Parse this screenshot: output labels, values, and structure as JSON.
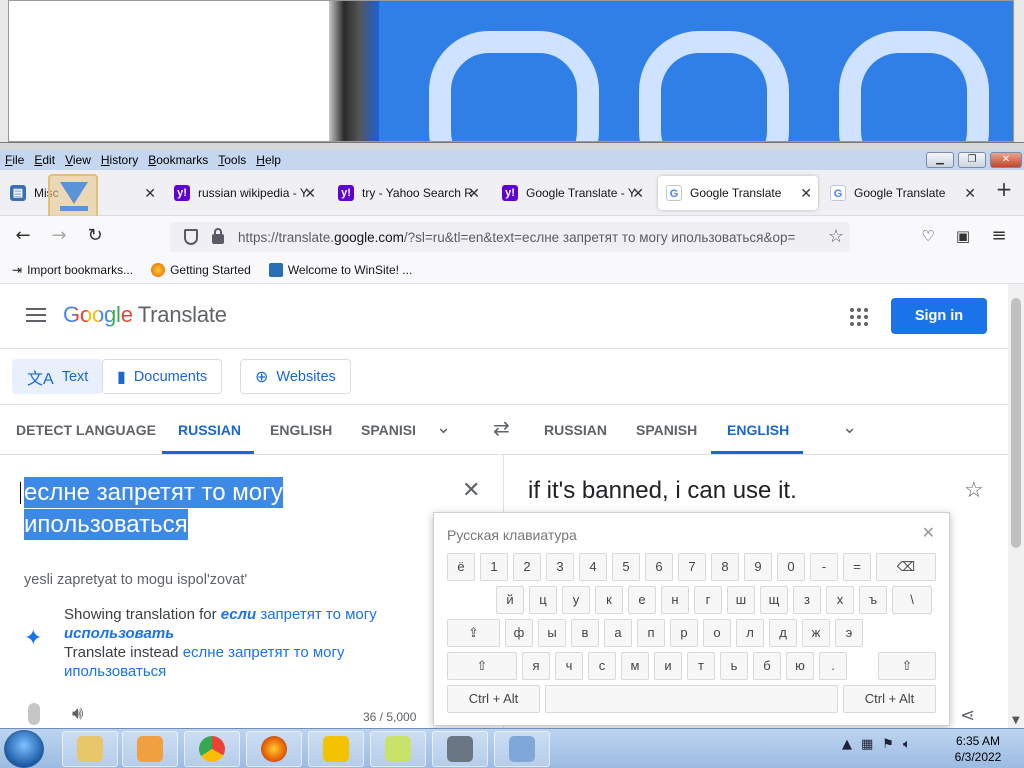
{
  "menubar": {
    "items": [
      "File",
      "Edit",
      "View",
      "History",
      "Bookmarks",
      "Tools",
      "Help"
    ]
  },
  "tabs": [
    {
      "label": "Misc",
      "icon": "folder-icon",
      "active": false
    },
    {
      "label": "russian wikipedia - Y",
      "icon": "yahoo-icon",
      "active": false
    },
    {
      "label": "try - Yahoo Search R",
      "icon": "yahoo-icon",
      "active": false
    },
    {
      "label": "Google Translate - Y",
      "icon": "yahoo-icon",
      "active": false
    },
    {
      "label": "Google Translate",
      "icon": "google-translate-icon",
      "active": true
    },
    {
      "label": "Google Translate",
      "icon": "google-translate-icon",
      "active": false
    }
  ],
  "url": {
    "prefix": "https://translate.",
    "domain": "google.com",
    "rest": "/?sl=ru&tl=en&text=еслне запретят то могу ипользоваться&op="
  },
  "bookmarks": [
    "Import bookmarks...",
    "Getting Started",
    "Welcome to WinSite! ..."
  ],
  "header": {
    "logo": "Google",
    "logo_suffix": "Translate",
    "signin": "Sign in"
  },
  "modes": [
    "Text",
    "Documents",
    "Websites"
  ],
  "source_langs": [
    "DETECT LANGUAGE",
    "RUSSIAN",
    "ENGLISH",
    "SPANISH"
  ],
  "target_langs": [
    "RUSSIAN",
    "SPANISH",
    "ENGLISH"
  ],
  "source": {
    "text_line1": "еслне запретят то могу",
    "text_line2": "ипользоваться",
    "transliteration": "yesli zapretyat to mogu ispol'zovat'",
    "showing_prefix": "Showing translation for",
    "showing_word1": "если",
    "showing_middle": "запретят то могу",
    "showing_word2": "использовать",
    "instead_prefix": "Translate instead",
    "instead_text": "еслне запретят то могу ипользоваться",
    "counter": "36 / 5,000"
  },
  "target": {
    "text": "if it's banned, i can use it."
  },
  "keyboard": {
    "title": "Русская клавиатура",
    "row1": [
      "ё",
      "1",
      "2",
      "3",
      "4",
      "5",
      "6",
      "7",
      "8",
      "9",
      "0",
      "-",
      "="
    ],
    "row2": [
      "й",
      "ц",
      "у",
      "к",
      "е",
      "н",
      "г",
      "ш",
      "щ",
      "з",
      "х",
      "ъ",
      "\\"
    ],
    "row3": [
      "ф",
      "ы",
      "в",
      "а",
      "п",
      "р",
      "о",
      "л",
      "д",
      "ж",
      "э"
    ],
    "row4": [
      "я",
      "ч",
      "с",
      "м",
      "и",
      "т",
      "ь",
      "б",
      "ю",
      "."
    ],
    "ctrl_alt": "Ctrl + Alt"
  },
  "clock": {
    "time": "6:35 AM",
    "date": "6/3/2022"
  },
  "colors": {
    "accent": "#1a73e8",
    "selection": "#3c8ae6"
  }
}
